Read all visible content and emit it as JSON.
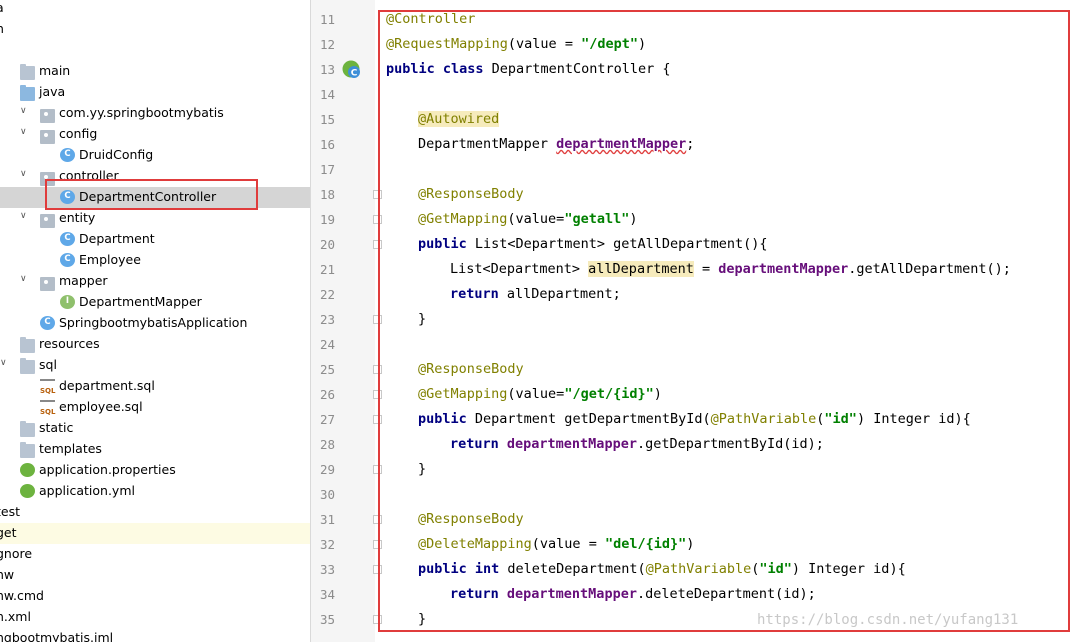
{
  "project_tree": {
    "items": [
      {
        "label": "a",
        "icon": "none",
        "arrow": "",
        "state": "normal"
      },
      {
        "label": "n",
        "icon": "none",
        "arrow": "",
        "state": "normal"
      },
      {
        "label": "",
        "icon": "none",
        "arrow": "",
        "state": "normal"
      },
      {
        "label": "main",
        "icon": "folder-icon",
        "arrow": "",
        "state": "normal"
      },
      {
        "label": "java",
        "icon": "source-folder-icon",
        "arrow": "",
        "state": "normal"
      },
      {
        "label": "com.yy.springbootmybatis",
        "icon": "package-icon",
        "arrow": "expanded",
        "state": "normal"
      },
      {
        "label": "config",
        "icon": "package-icon",
        "arrow": "expanded",
        "state": "normal"
      },
      {
        "label": "DruidConfig",
        "icon": "class-icon",
        "arrow": "",
        "state": "normal"
      },
      {
        "label": "controller",
        "icon": "package-icon",
        "arrow": "expanded",
        "state": "normal"
      },
      {
        "label": "DepartmentController",
        "icon": "class-icon",
        "arrow": "",
        "state": "selected"
      },
      {
        "label": "entity",
        "icon": "package-icon",
        "arrow": "expanded",
        "state": "normal"
      },
      {
        "label": "Department",
        "icon": "class-icon",
        "arrow": "",
        "state": "normal"
      },
      {
        "label": "Employee",
        "icon": "class-icon",
        "arrow": "",
        "state": "normal"
      },
      {
        "label": "mapper",
        "icon": "package-icon",
        "arrow": "expanded",
        "state": "normal"
      },
      {
        "label": "DepartmentMapper",
        "icon": "interface-icon",
        "arrow": "",
        "state": "normal"
      },
      {
        "label": "SpringbootmybatisApplication",
        "icon": "spring-boot-class-icon",
        "arrow": "",
        "state": "normal"
      },
      {
        "label": "resources",
        "icon": "resources-folder-icon",
        "arrow": "",
        "state": "normal"
      },
      {
        "label": "sql",
        "icon": "folder-icon",
        "arrow": "expanded",
        "state": "normal"
      },
      {
        "label": "department.sql",
        "icon": "sql-file-icon",
        "arrow": "",
        "state": "normal"
      },
      {
        "label": "employee.sql",
        "icon": "sql-file-icon",
        "arrow": "",
        "state": "normal"
      },
      {
        "label": "static",
        "icon": "folder-icon",
        "arrow": "",
        "state": "normal"
      },
      {
        "label": "templates",
        "icon": "folder-icon",
        "arrow": "",
        "state": "normal"
      },
      {
        "label": "application.properties",
        "icon": "spring-config-icon",
        "arrow": "",
        "state": "normal"
      },
      {
        "label": "application.yml",
        "icon": "spring-config-icon",
        "arrow": "",
        "state": "normal"
      },
      {
        "label": "test",
        "icon": "none",
        "arrow": "",
        "state": "normal"
      },
      {
        "label": "get",
        "icon": "none",
        "arrow": "",
        "state": "highlight"
      },
      {
        "label": "gnore",
        "icon": "none",
        "arrow": "",
        "state": "normal"
      },
      {
        "label": "nw",
        "icon": "none",
        "arrow": "",
        "state": "normal"
      },
      {
        "label": "nw.cmd",
        "icon": "none",
        "arrow": "",
        "state": "normal"
      },
      {
        "label": "n.xml",
        "icon": "none",
        "arrow": "",
        "state": "normal"
      },
      {
        "label": "ngbootmybatis.iml",
        "icon": "none",
        "arrow": "",
        "state": "normal"
      }
    ]
  },
  "editor": {
    "line_numbers": [
      "11",
      "12",
      "13",
      "14",
      "15",
      "16",
      "17",
      "18",
      "19",
      "20",
      "21",
      "22",
      "23",
      "24",
      "25",
      "26",
      "27",
      "28",
      "29",
      "30",
      "31",
      "32",
      "33",
      "34",
      "35"
    ],
    "lines": [
      {
        "indent": 0,
        "tokens": [
          {
            "t": "@Controller",
            "c": "ann"
          }
        ]
      },
      {
        "indent": 0,
        "tokens": [
          {
            "t": "@RequestMapping",
            "c": "ann"
          },
          {
            "t": "(value = ",
            "c": ""
          },
          {
            "t": "\"/dept\"",
            "c": "str"
          },
          {
            "t": ")",
            "c": ""
          }
        ]
      },
      {
        "indent": 0,
        "tokens": [
          {
            "t": "public class ",
            "c": "kw"
          },
          {
            "t": "DepartmentController {",
            "c": ""
          }
        ]
      },
      {
        "indent": 0,
        "tokens": []
      },
      {
        "indent": 1,
        "tokens": [
          {
            "t": "@Autowired",
            "c": "ann hl"
          }
        ]
      },
      {
        "indent": 1,
        "tokens": [
          {
            "t": "DepartmentMapper ",
            "c": ""
          },
          {
            "t": "departmentMapper",
            "c": "fld warn"
          },
          {
            "t": ";",
            "c": ""
          }
        ]
      },
      {
        "indent": 0,
        "tokens": []
      },
      {
        "indent": 1,
        "tokens": [
          {
            "t": "@ResponseBody",
            "c": "ann"
          }
        ]
      },
      {
        "indent": 1,
        "tokens": [
          {
            "t": "@GetMapping",
            "c": "ann"
          },
          {
            "t": "(value=",
            "c": ""
          },
          {
            "t": "\"getall\"",
            "c": "str"
          },
          {
            "t": ")",
            "c": ""
          }
        ]
      },
      {
        "indent": 1,
        "tokens": [
          {
            "t": "public ",
            "c": "kw"
          },
          {
            "t": "List<Department> getAllDepartment(){",
            "c": ""
          }
        ]
      },
      {
        "indent": 2,
        "tokens": [
          {
            "t": "List<Department> ",
            "c": ""
          },
          {
            "t": "allDepartment",
            "c": "hl"
          },
          {
            "t": " = ",
            "c": ""
          },
          {
            "t": "departmentMapper",
            "c": "fld"
          },
          {
            "t": ".getAllDepartment();",
            "c": ""
          }
        ]
      },
      {
        "indent": 2,
        "tokens": [
          {
            "t": "return ",
            "c": "kw"
          },
          {
            "t": "allDepartment;",
            "c": ""
          }
        ]
      },
      {
        "indent": 1,
        "tokens": [
          {
            "t": "}",
            "c": ""
          }
        ]
      },
      {
        "indent": 0,
        "tokens": []
      },
      {
        "indent": 1,
        "tokens": [
          {
            "t": "@ResponseBody",
            "c": "ann"
          }
        ]
      },
      {
        "indent": 1,
        "tokens": [
          {
            "t": "@GetMapping",
            "c": "ann"
          },
          {
            "t": "(value=",
            "c": ""
          },
          {
            "t": "\"/get/{id}\"",
            "c": "str"
          },
          {
            "t": ")",
            "c": ""
          }
        ]
      },
      {
        "indent": 1,
        "tokens": [
          {
            "t": "public ",
            "c": "kw"
          },
          {
            "t": "Department getDepartmentById(",
            "c": ""
          },
          {
            "t": "@PathVariable",
            "c": "ann"
          },
          {
            "t": "(",
            "c": ""
          },
          {
            "t": "\"id\"",
            "c": "str"
          },
          {
            "t": ") Integer id){",
            "c": ""
          }
        ]
      },
      {
        "indent": 2,
        "tokens": [
          {
            "t": "return ",
            "c": "kw"
          },
          {
            "t": "departmentMapper",
            "c": "fld"
          },
          {
            "t": ".getDepartmentById(id);",
            "c": ""
          }
        ]
      },
      {
        "indent": 1,
        "tokens": [
          {
            "t": "}",
            "c": ""
          }
        ]
      },
      {
        "indent": 0,
        "tokens": []
      },
      {
        "indent": 1,
        "tokens": [
          {
            "t": "@ResponseBody",
            "c": "ann"
          }
        ]
      },
      {
        "indent": 1,
        "tokens": [
          {
            "t": "@DeleteMapping",
            "c": "ann"
          },
          {
            "t": "(value = ",
            "c": ""
          },
          {
            "t": "\"del/{id}\"",
            "c": "str"
          },
          {
            "t": ")",
            "c": ""
          }
        ]
      },
      {
        "indent": 1,
        "tokens": [
          {
            "t": "public int ",
            "c": "kw"
          },
          {
            "t": "deleteDepartment(",
            "c": ""
          },
          {
            "t": "@PathVariable",
            "c": "ann"
          },
          {
            "t": "(",
            "c": ""
          },
          {
            "t": "\"id\"",
            "c": "str"
          },
          {
            "t": ") Integer id){",
            "c": ""
          }
        ]
      },
      {
        "indent": 2,
        "tokens": [
          {
            "t": "return ",
            "c": "kw"
          },
          {
            "t": "departmentMapper",
            "c": "fld"
          },
          {
            "t": ".deleteDepartment(id);",
            "c": ""
          }
        ]
      },
      {
        "indent": 1,
        "tokens": [
          {
            "t": "}",
            "c": ""
          }
        ]
      }
    ],
    "fold_markers": [
      "18",
      "19",
      "20",
      "23",
      "25",
      "26",
      "27",
      "29",
      "31",
      "32",
      "33",
      "35"
    ],
    "gutter_icon_line": "13",
    "gutter_icon": "spring-bean-icon"
  },
  "colors": {
    "annotation": "#808000",
    "keyword": "#000080",
    "string": "#008000",
    "field": "#660e7a",
    "highlight_box": "#e03c3c"
  },
  "watermark": "https://blog.csdn.net/yufang131"
}
